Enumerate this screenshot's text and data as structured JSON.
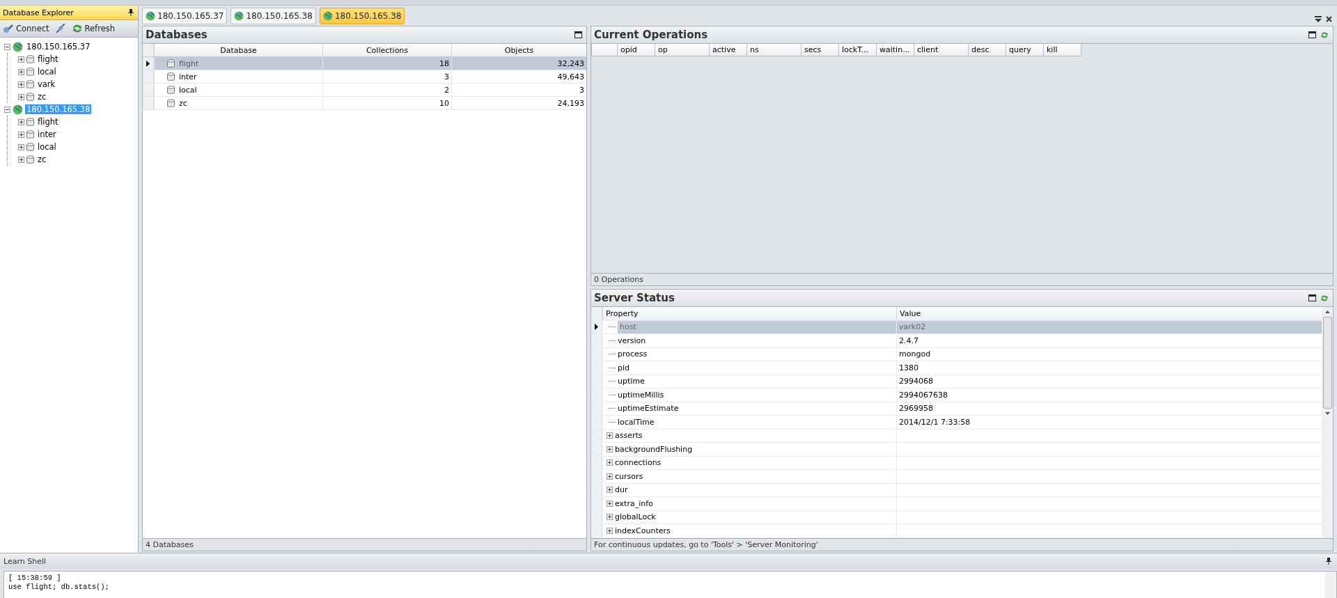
{
  "top_tabs": [
    {
      "label": "180.150.165.37",
      "selected": false
    },
    {
      "label": "180.150.165.38",
      "selected": false
    },
    {
      "label": "180.150.165.38",
      "selected": true
    }
  ],
  "explorer": {
    "title": "Database Explorer",
    "connect": "Connect",
    "refresh": "Refresh",
    "tree": [
      {
        "label": "180.150.165.37",
        "expanded": true,
        "selected": false,
        "children": [
          {
            "label": "flight",
            "expanded": false
          },
          {
            "label": "local",
            "expanded": false
          },
          {
            "label": "vark",
            "expanded": false
          },
          {
            "label": "zc",
            "expanded": false
          }
        ]
      },
      {
        "label": "180.150.165.38",
        "expanded": true,
        "selected": true,
        "children": [
          {
            "label": "flight",
            "expanded": false
          },
          {
            "label": "inter",
            "expanded": false
          },
          {
            "label": "local",
            "expanded": false
          },
          {
            "label": "zc",
            "expanded": false
          }
        ]
      }
    ]
  },
  "databases": {
    "title": "Databases",
    "columns": [
      "Database",
      "Collections",
      "Objects"
    ],
    "rows": [
      {
        "database": "flight",
        "collections": "18",
        "objects": "32,243",
        "selected": true
      },
      {
        "database": "inter",
        "collections": "3",
        "objects": "49,643",
        "selected": false
      },
      {
        "database": "local",
        "collections": "2",
        "objects": "3",
        "selected": false
      },
      {
        "database": "zc",
        "collections": "10",
        "objects": "24,193",
        "selected": false
      }
    ],
    "status": "4 Databases"
  },
  "operations": {
    "title": "Current Operations",
    "columns": [
      "opid",
      "op",
      "active",
      "ns",
      "secs",
      "lockT...",
      "waitin...",
      "client",
      "desc",
      "query",
      "kill"
    ],
    "status": "0 Operations"
  },
  "server_status": {
    "title": "Server Status",
    "columns": [
      "Property",
      "Value"
    ],
    "rows": [
      {
        "property": "host",
        "value": "vark02",
        "kind": "leaf",
        "selected": true
      },
      {
        "property": "version",
        "value": "2.4.7",
        "kind": "leaf",
        "selected": false
      },
      {
        "property": "process",
        "value": "mongod",
        "kind": "leaf",
        "selected": false
      },
      {
        "property": "pid",
        "value": "1380",
        "kind": "leaf",
        "selected": false
      },
      {
        "property": "uptime",
        "value": "2994068",
        "kind": "leaf",
        "selected": false
      },
      {
        "property": "uptimeMillis",
        "value": "2994067638",
        "kind": "leaf",
        "selected": false
      },
      {
        "property": "uptimeEstimate",
        "value": "2969958",
        "kind": "leaf",
        "selected": false
      },
      {
        "property": "localTime",
        "value": "2014/12/1 7:33:58",
        "kind": "leaf",
        "selected": false
      },
      {
        "property": "asserts",
        "kind": "group",
        "selected": false
      },
      {
        "property": "backgroundFlushing",
        "kind": "group",
        "selected": false
      },
      {
        "property": "connections",
        "kind": "group",
        "selected": false
      },
      {
        "property": "cursors",
        "kind": "group",
        "selected": false
      },
      {
        "property": "dur",
        "kind": "group",
        "selected": false
      },
      {
        "property": "extra_info",
        "kind": "group",
        "selected": false
      },
      {
        "property": "globalLock",
        "kind": "group",
        "selected": false
      },
      {
        "property": "indexCounters",
        "kind": "group",
        "selected": false
      }
    ],
    "status": "For continuous updates, go to 'Tools' > 'Server Monitoring'"
  },
  "shell": {
    "title": "Learn Shell",
    "lines": [
      "[ 15:38:59 ]",
      "use flight; db.stats();"
    ]
  }
}
